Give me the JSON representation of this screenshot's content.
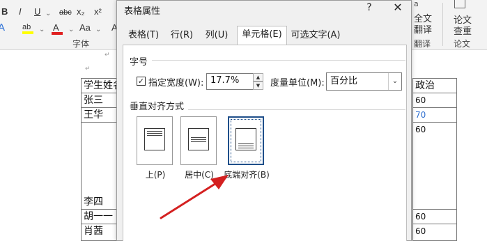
{
  "ribbon": {
    "font_tools": [
      "B",
      "I",
      "U",
      "abc",
      "x₂",
      "x²"
    ],
    "font_tools_row2": [
      "A",
      "ab",
      "A",
      "Aa",
      "A"
    ],
    "paragraph_group_label": "字体",
    "translate_top": "全文",
    "translate_bottom": "翻译",
    "translate_group_label": "翻译",
    "paper_top": "论文",
    "paper_bottom": "查重",
    "paper_group_label": "论文"
  },
  "document": {
    "rows": [
      {
        "name": "学生姓名",
        "grade": "政治"
      },
      {
        "name": "张三",
        "grade": "60"
      },
      {
        "name": "王华",
        "grade": "70"
      },
      {
        "name": "",
        "grade": "60"
      },
      {
        "name": "李四",
        "grade": ""
      },
      {
        "name": "胡一一",
        "grade": "60"
      },
      {
        "name": "肖茜",
        "grade": "60"
      }
    ]
  },
  "dialog": {
    "title": "表格属性",
    "help": "?",
    "close": "✕",
    "tabs": [
      {
        "label": "表格(T)"
      },
      {
        "label": "行(R)"
      },
      {
        "label": "列(U)"
      },
      {
        "label": "单元格(E)"
      },
      {
        "label": "可选文字(A)"
      }
    ],
    "size_section": "字号",
    "specify_width_label": "指定宽度(W):",
    "specify_width_checked": true,
    "width_value": "17.7%",
    "unit_label": "度量单位(M):",
    "unit_value": "百分比",
    "valign_section": "垂直对齐方式",
    "valign_options": [
      {
        "label": "上(P)"
      },
      {
        "label": "居中(C)"
      },
      {
        "label": "底端对齐(B)"
      }
    ],
    "selected_valign": "底端对齐(B)"
  }
}
